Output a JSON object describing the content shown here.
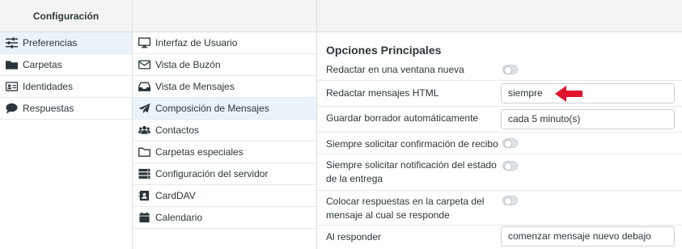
{
  "col1": {
    "header": "Configuración",
    "items": [
      {
        "label": "Preferencias",
        "icon": "sliders-icon"
      },
      {
        "label": "Carpetas",
        "icon": "folder-icon"
      },
      {
        "label": "Identidades",
        "icon": "id-card-icon"
      },
      {
        "label": "Respuestas",
        "icon": "comment-icon"
      }
    ]
  },
  "col2": {
    "items": [
      {
        "label": "Interfaz de Usuario",
        "icon": "monitor-icon"
      },
      {
        "label": "Vista de Buzón",
        "icon": "envelope-icon"
      },
      {
        "label": "Vista de Mensajes",
        "icon": "inbox-icon"
      },
      {
        "label": "Composición de Mensajes",
        "icon": "paper-plane-icon"
      },
      {
        "label": "Contactos",
        "icon": "users-icon"
      },
      {
        "label": "Carpetas especiales",
        "icon": "folder-outline-icon"
      },
      {
        "label": "Configuración del servidor",
        "icon": "server-icon"
      },
      {
        "label": "CardDAV",
        "icon": "address-card-icon"
      },
      {
        "label": "Calendario",
        "icon": "calendar-icon"
      }
    ]
  },
  "main": {
    "title": "Opciones Principales",
    "rows": [
      {
        "label": "Redactar en una ventana nueva",
        "type": "toggle",
        "value": "off"
      },
      {
        "label": "Redactar mensajes HTML",
        "type": "select",
        "value": "siempre"
      },
      {
        "label": "Guardar borrador automáticamente",
        "type": "select",
        "value": "cada 5 minuto(s)"
      },
      {
        "label": "Siempre solicitar confirmación de recibo",
        "type": "toggle",
        "value": "off"
      },
      {
        "label": "Siempre solicitar notificación del estado de la entrega",
        "type": "toggle",
        "value": "off"
      },
      {
        "label": "Colocar respuestas en la carpeta del mensaje al cual se responde",
        "type": "toggle",
        "value": "off"
      },
      {
        "label": "Al responder",
        "type": "select",
        "value": "comenzar mensaje nuevo debajo"
      }
    ]
  },
  "colors": {
    "accent": "#e0142d",
    "selected_bg": "#eaf3fa"
  }
}
